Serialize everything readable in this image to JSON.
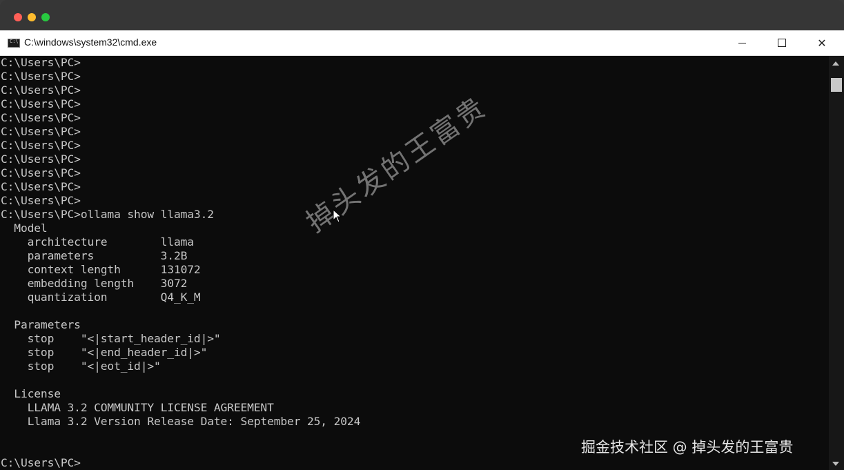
{
  "window": {
    "title": "C:\\windows\\system32\\cmd.exe",
    "icon_label": "C:\\"
  },
  "console": {
    "lines": [
      "C:\\Users\\PC>",
      "C:\\Users\\PC>",
      "C:\\Users\\PC>",
      "C:\\Users\\PC>",
      "C:\\Users\\PC>",
      "C:\\Users\\PC>",
      "C:\\Users\\PC>",
      "C:\\Users\\PC>",
      "C:\\Users\\PC>",
      "C:\\Users\\PC>",
      "C:\\Users\\PC>",
      "C:\\Users\\PC>ollama show llama3.2",
      "  Model",
      "    architecture        llama",
      "    parameters          3.2B",
      "    context length      131072",
      "    embedding length    3072",
      "    quantization        Q4_K_M",
      "",
      "  Parameters",
      "    stop    \"<|start_header_id|>\"",
      "    stop    \"<|end_header_id|>\"",
      "    stop    \"<|eot_id|>\"",
      "",
      "  License",
      "    LLAMA 3.2 COMMUNITY LICENSE AGREEMENT",
      "    Llama 3.2 Version Release Date: September 25, 2024",
      "",
      "",
      "C:\\Users\\PC>"
    ]
  },
  "watermark": "掉头发的王富贵",
  "credit": "掘金技术社区 @ 掉头发的王富贵"
}
